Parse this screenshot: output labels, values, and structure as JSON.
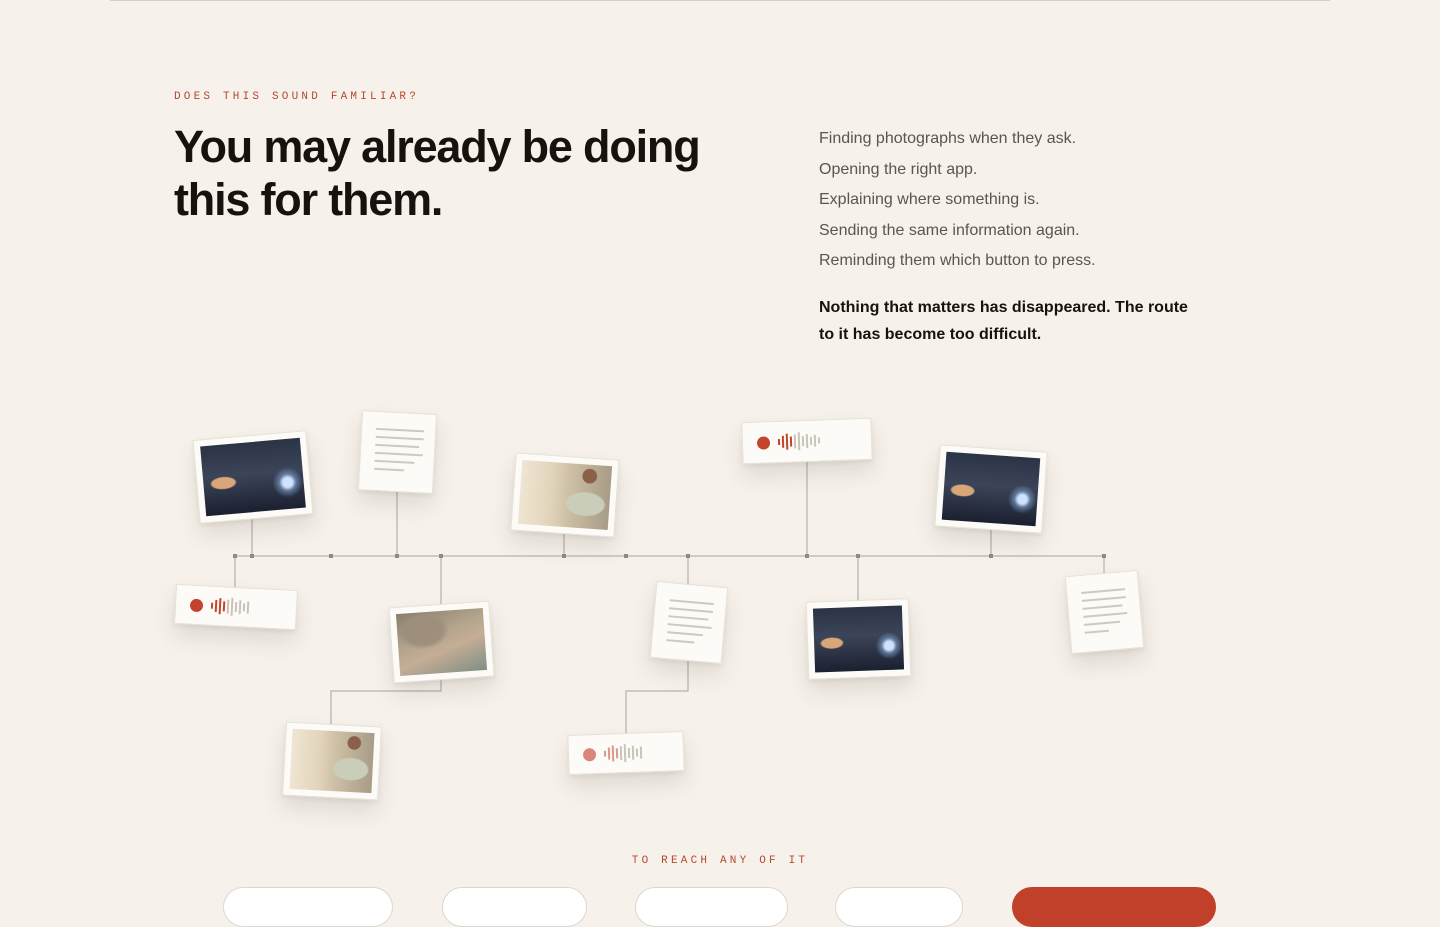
{
  "section": {
    "eyebrow": "DOES THIS SOUND FAMILIAR?",
    "headline": "You may already be doing this for them.",
    "list": [
      "Finding photographs when they ask.",
      "Opening the right app.",
      "Explaining where something is.",
      "Sending the same information again.",
      "Reminding them which button to press."
    ],
    "closing": "Nothing that matters has disappeared. The route to it has become too difficult."
  },
  "reach": {
    "eyebrow": "TO REACH ANY OF IT"
  },
  "colors": {
    "background": "#f6f2eb",
    "accent": "#c0402a",
    "text": "#16130f",
    "muted": "#5a554e",
    "line": "#a8a39b"
  },
  "timeline_items": [
    {
      "kind": "photo",
      "icon": "photo-icon"
    },
    {
      "kind": "document",
      "icon": "document-icon"
    },
    {
      "kind": "photo",
      "icon": "photo-icon"
    },
    {
      "kind": "voice-note",
      "icon": "record-dot-icon"
    },
    {
      "kind": "photo",
      "icon": "photo-icon"
    },
    {
      "kind": "voice-note",
      "icon": "record-dot-icon"
    },
    {
      "kind": "photo",
      "icon": "photo-icon"
    },
    {
      "kind": "document",
      "icon": "document-icon"
    },
    {
      "kind": "photo",
      "icon": "photo-icon"
    },
    {
      "kind": "document",
      "icon": "document-icon"
    },
    {
      "kind": "photo",
      "icon": "photo-icon"
    },
    {
      "kind": "voice-note",
      "icon": "record-dot-icon"
    }
  ]
}
